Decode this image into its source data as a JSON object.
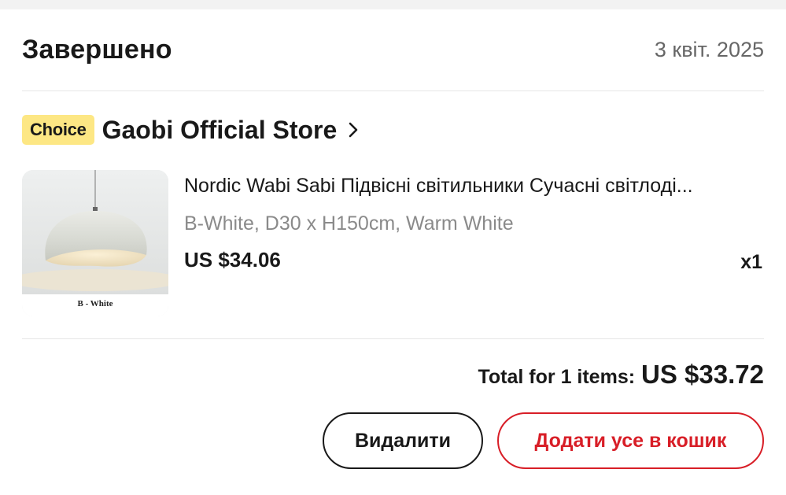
{
  "order": {
    "status": "Завершено",
    "date": "3 квіт. 2025"
  },
  "store": {
    "badge": "Choice",
    "name": "Gaobi Official Store",
    "chevron_icon": "chevron-right-icon"
  },
  "item": {
    "title": "Nordic Wabi Sabi Підвісні світильники Сучасні світлоді...",
    "sku": "B-White, D30 x H150cm, Warm White",
    "price": "US $34.06",
    "quantity": "x1",
    "image_caption": "B - White"
  },
  "summary": {
    "total_label": "Total for 1 items:",
    "total_value": "US $33.72"
  },
  "actions": {
    "delete_label": "Видалити",
    "add_all_label": "Додати усе в кошик"
  },
  "colors": {
    "badge_bg": "#fde784",
    "accent_red": "#d81e27",
    "text_primary": "#191919",
    "text_secondary": "#8a8a8a"
  }
}
